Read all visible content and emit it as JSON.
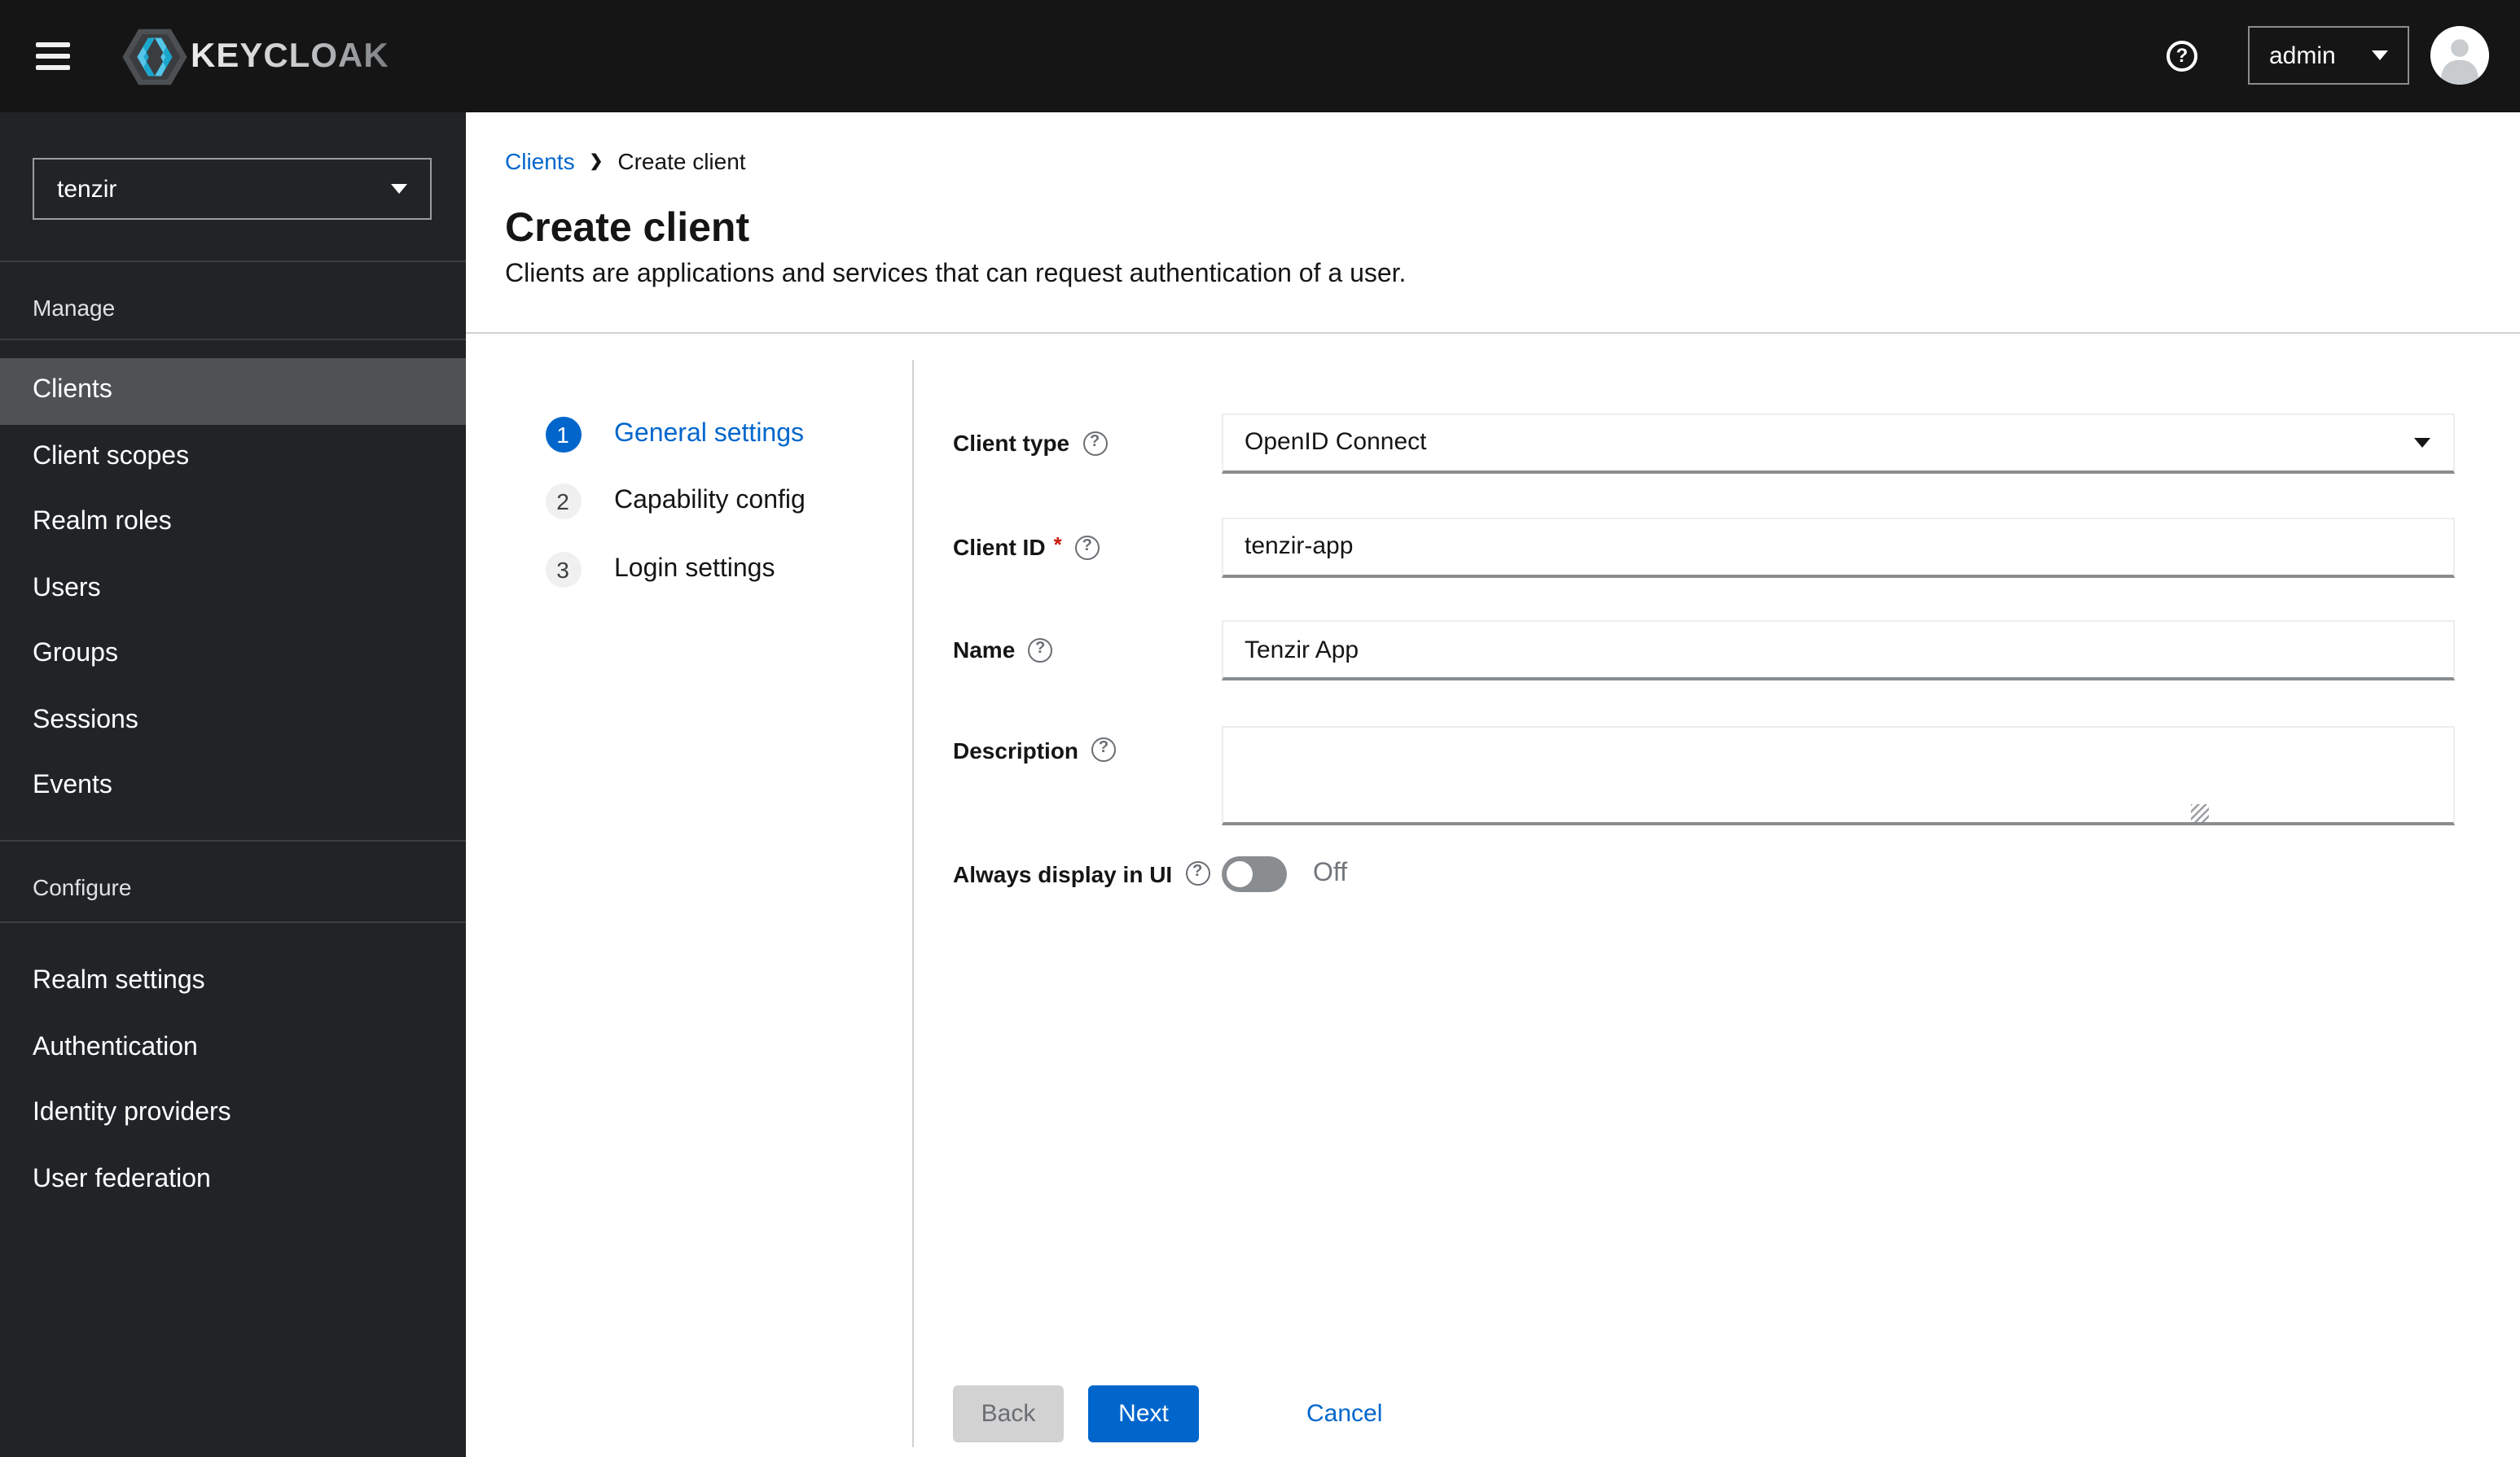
{
  "masthead": {
    "brand": "KEYCLOAK",
    "user": "admin"
  },
  "sidebar": {
    "realm": "tenzir",
    "sections": [
      {
        "title": "Manage",
        "items": [
          {
            "label": "Clients",
            "active": true
          },
          {
            "label": "Client scopes"
          },
          {
            "label": "Realm roles"
          },
          {
            "label": "Users"
          },
          {
            "label": "Groups"
          },
          {
            "label": "Sessions"
          },
          {
            "label": "Events"
          }
        ]
      },
      {
        "title": "Configure",
        "items": [
          {
            "label": "Realm settings"
          },
          {
            "label": "Authentication"
          },
          {
            "label": "Identity providers"
          },
          {
            "label": "User federation"
          }
        ]
      }
    ]
  },
  "breadcrumb": {
    "items": [
      "Clients",
      "Create client"
    ]
  },
  "page": {
    "title": "Create client",
    "subtitle": "Clients are applications and services that can request authentication of a user."
  },
  "wizard": {
    "steps": [
      {
        "num": "1",
        "label": "General settings",
        "active": true
      },
      {
        "num": "2",
        "label": "Capability config",
        "active": false
      },
      {
        "num": "3",
        "label": "Login settings",
        "active": false
      }
    ]
  },
  "form": {
    "client_type": {
      "label": "Client type",
      "value": "OpenID Connect"
    },
    "client_id": {
      "label": "Client ID",
      "required_marker": "*",
      "value": "tenzir-app"
    },
    "name": {
      "label": "Name",
      "value": "Tenzir App"
    },
    "description": {
      "label": "Description",
      "value": ""
    },
    "always_display": {
      "label": "Always display in UI",
      "state": "Off"
    }
  },
  "footer": {
    "back": "Back",
    "next": "Next",
    "cancel": "Cancel"
  },
  "colors": {
    "accent": "#0066cc",
    "masthead_bg": "#151515",
    "sidebar_bg": "#212427",
    "sidebar_active_bg": "#4f5255",
    "required_red": "#c9190b",
    "divider": "#d2d2d2",
    "control_border_bottom": "#8a8d90",
    "logo_cyan": "#2cb8e0"
  }
}
